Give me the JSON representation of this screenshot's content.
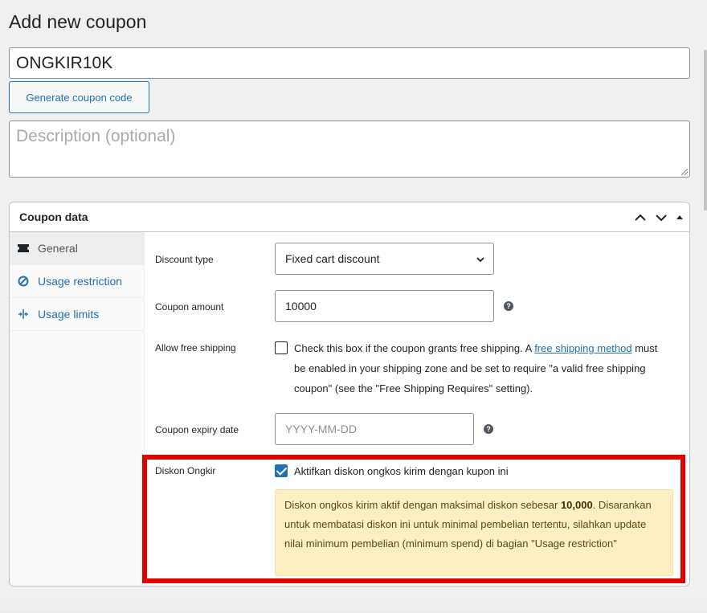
{
  "page": {
    "title": "Add new coupon"
  },
  "coupon_code": {
    "value": "ONGKIR10K"
  },
  "generate_button": {
    "label": "Generate coupon code"
  },
  "description": {
    "placeholder": "Description (optional)"
  },
  "coupon_data": {
    "title": "Coupon data",
    "tabs": [
      {
        "label": "General",
        "icon": "ticket-icon",
        "active": true
      },
      {
        "label": "Usage restriction",
        "icon": "restriction-icon",
        "active": false
      },
      {
        "label": "Usage limits",
        "icon": "limits-icon",
        "active": false
      }
    ],
    "general": {
      "discount_type": {
        "label": "Discount type",
        "value": "Fixed cart discount"
      },
      "coupon_amount": {
        "label": "Coupon amount",
        "value": "10000"
      },
      "free_shipping": {
        "label": "Allow free shipping",
        "text_before": "Check this box if the coupon grants free shipping. A ",
        "link_text": "free shipping method",
        "text_after": " must be enabled in your shipping zone and be set to require \"a valid free shipping coupon\" (see the \"Free Shipping Requires\" setting).",
        "checked": false
      },
      "expiry": {
        "label": "Coupon expiry date",
        "placeholder": "YYYY-MM-DD"
      },
      "diskon_ongkir": {
        "label": "Diskon Ongkir",
        "checkbox_label": "Aktifkan diskon ongkos kirim dengan kupon ini",
        "checked": true,
        "notice_before": "Diskon ongkos kirim aktif dengan maksimal diskon sebesar ",
        "notice_amount": "10,000",
        "notice_after": ". Disarankan untuk membatasi diskon ini untuk minimal pembelian tertentu, silahkan update nilai minimum pembelian (minimum spend) di bagian \"Usage restriction\""
      }
    }
  },
  "colors": {
    "accent": "#2271b1",
    "highlight": "#e00000",
    "notice_bg": "#fcf0c3"
  }
}
